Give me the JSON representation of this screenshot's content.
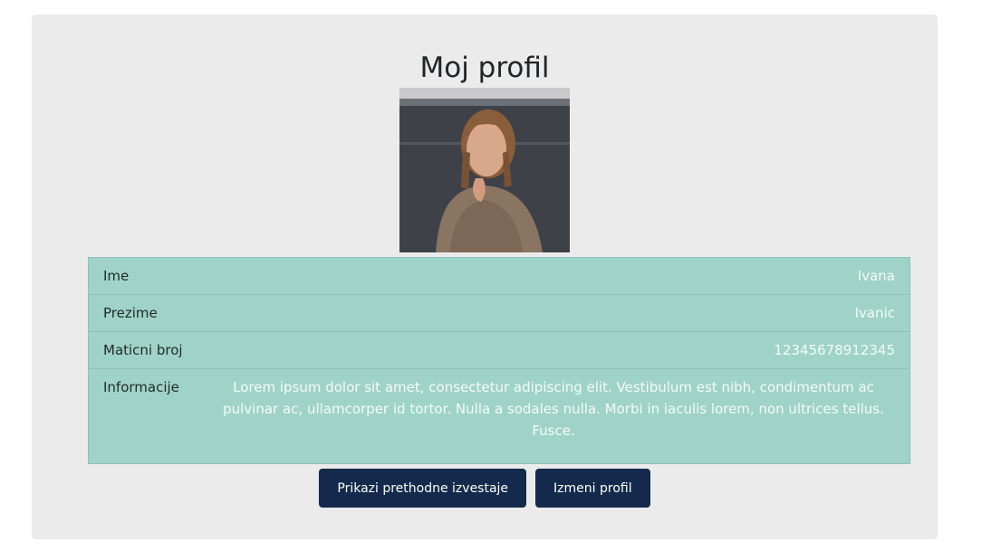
{
  "profile": {
    "title": "Moj profil",
    "rows": [
      {
        "label": "Ime",
        "value": "Ivana"
      },
      {
        "label": "Prezime",
        "value": "Ivanic"
      },
      {
        "label": "Maticni broj",
        "value": "12345678912345"
      },
      {
        "label": "Informacije",
        "value": "Lorem ipsum dolor sit amet, consectetur adipiscing elit. Vestibulum est nibh, condimentum ac pulvinar ac, ullamcorper id tortor. Nulla a sodales nulla. Morbi in iaculis lorem, non ultrices tellus. Fusce."
      }
    ]
  },
  "actions": {
    "show_reports_label": "Prikazi prethodne izvestaje",
    "edit_profile_label": "Izmeni profil"
  },
  "colors": {
    "card_bg": "#ebebeb",
    "table_bg": "#a0d3c7",
    "button_bg": "#142a4c"
  }
}
